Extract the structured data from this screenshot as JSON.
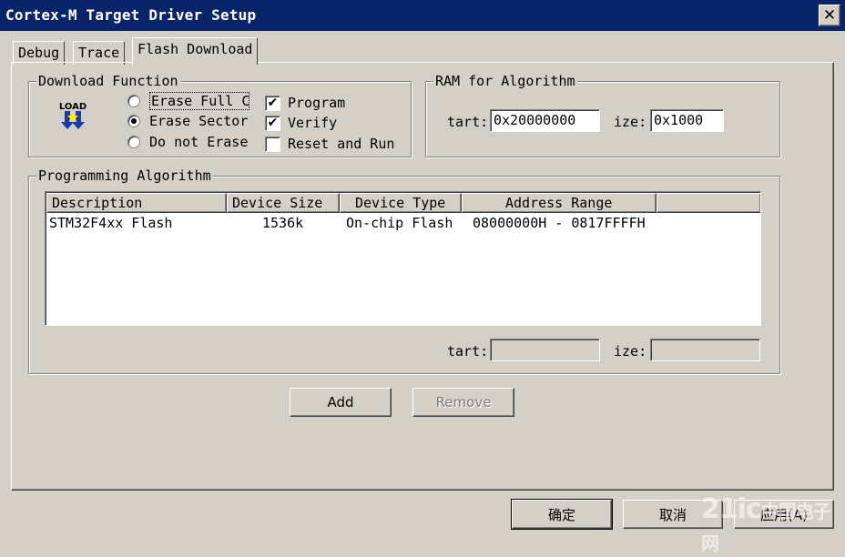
{
  "window": {
    "title": "Cortex-M Target Driver Setup",
    "close_glyph": "✕"
  },
  "tabs": [
    {
      "label": "Debug"
    },
    {
      "label": "Trace"
    },
    {
      "label": "Flash Download",
      "active": true
    }
  ],
  "download_function": {
    "legend": "Download Function",
    "icon_label": "LOAD",
    "radios": [
      {
        "label": "Erase Full C",
        "selected": false
      },
      {
        "label": "Erase Sector:",
        "selected": true
      },
      {
        "label": "Do not Erase",
        "selected": false
      }
    ],
    "checkboxes": [
      {
        "label": "Program",
        "checked": true
      },
      {
        "label": "Verify",
        "checked": true
      },
      {
        "label": "Reset and Run",
        "checked": false
      }
    ]
  },
  "ram_for_algorithm": {
    "legend": "RAM for Algorithm",
    "start_label": "tart:",
    "start_value": "0x20000000",
    "size_label": "ize:",
    "size_value": "0x1000"
  },
  "programming_algorithm": {
    "legend": "Programming Algorithm",
    "columns": [
      "Description",
      "Device Size",
      "Device Type",
      "Address Range"
    ],
    "rows": [
      {
        "description": "STM32F4xx Flash",
        "device_size": "1536k",
        "device_type": "On-chip Flash",
        "address_range": "08000000H - 0817FFFFH"
      }
    ],
    "start_label": "tart:",
    "start_value": "",
    "size_label": "ize:",
    "size_value": ""
  },
  "buttons": {
    "add": "Add",
    "remove": "Remove",
    "ok": "确定",
    "cancel": "取消",
    "apply": "应用(A)"
  },
  "watermark": {
    "text": "21ic",
    "sub": "中国电子网"
  },
  "colors": {
    "titlebar": "#0a246a",
    "face": "#d4d0c8"
  }
}
